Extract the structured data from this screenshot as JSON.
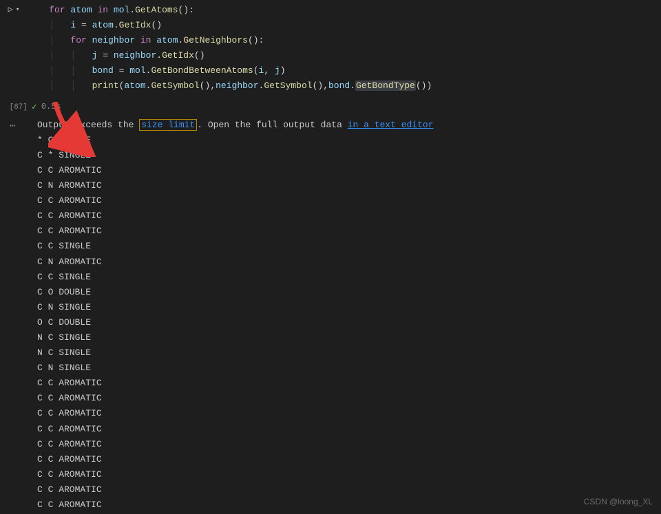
{
  "cell": {
    "execution_count_label": "[87]",
    "run_icon": "▷",
    "chevron_icon": "▾",
    "status_icon": "✓",
    "exec_time": "0.5s"
  },
  "code": {
    "l1": {
      "kw1": "for",
      "v1": "atom",
      "kw2": "in",
      "v2": "mol",
      "dot": ".",
      "fn": "GetAtoms",
      "paren": "():"
    },
    "l2": {
      "v1": "i",
      "eq": " = ",
      "v2": "atom",
      "dot": ".",
      "fn": "GetIdx",
      "paren": "()"
    },
    "l3": {
      "kw1": "for",
      "v1": "neighbor",
      "kw2": "in",
      "v2": "atom",
      "dot": ".",
      "fn": "GetNeighbors",
      "paren": "():"
    },
    "l4": {
      "v1": "j",
      "eq": " = ",
      "v2": "neighbor",
      "dot": ".",
      "fn": "GetIdx",
      "paren": "()"
    },
    "l5": {
      "v1": "bond",
      "eq": " = ",
      "v2": "mol",
      "dot": ".",
      "fn": "GetBondBetweenAtoms",
      "paren": "(",
      "a1": "i",
      "comma": ", ",
      "a2": "j",
      "paren2": ")"
    },
    "l6": {
      "fn1": "print",
      "p1": "(",
      "v1": "atom",
      "d1": ".",
      "fn2": "GetSymbol",
      "p2": "()",
      "c1": ",",
      "v2": "neighbor",
      "d2": ".",
      "fn3": "GetSymbol",
      "p3": "()",
      "c2": ",",
      "v3": "bond",
      "d3": ".",
      "fn4": "GetBondType",
      "p4": "()",
      "p5": ")"
    }
  },
  "output": {
    "truncate_msg_a": "Output exceeds the ",
    "truncate_link1": "size limit",
    "truncate_msg_b": ". Open the full output data ",
    "truncate_link2": "in a text editor",
    "lines": [
      "* C SINGLE",
      "C * SINGLE",
      "C C AROMATIC",
      "C N AROMATIC",
      "C C AROMATIC",
      "C C AROMATIC",
      "C C AROMATIC",
      "C C SINGLE",
      "C N AROMATIC",
      "C C SINGLE",
      "C O DOUBLE",
      "C N SINGLE",
      "O C DOUBLE",
      "N C SINGLE",
      "N C SINGLE",
      "C N SINGLE",
      "C C AROMATIC",
      "C C AROMATIC",
      "C C AROMATIC",
      "C C AROMATIC",
      "C C AROMATIC",
      "C C AROMATIC",
      "C C AROMATIC",
      "C C AROMATIC",
      "C C AROMATIC"
    ]
  },
  "watermark": "CSDN @loong_XL"
}
